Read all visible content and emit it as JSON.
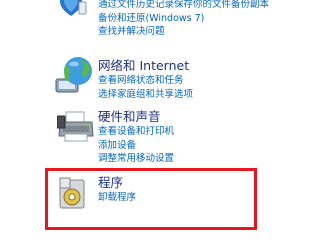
{
  "system": {
    "links": [
      "通过文件历史记录保存你的文件备份副本",
      "备份和还原(Windows 7)",
      "查找并解决问题"
    ]
  },
  "network": {
    "title": "网络和 Internet",
    "links": [
      "查看网络状态和任务",
      "选择家庭组和共享选项"
    ]
  },
  "hardware": {
    "title": "硬件和声音",
    "links": [
      "查看设备和打印机",
      "添加设备",
      "调整常用移动设置"
    ]
  },
  "programs": {
    "title": "程序",
    "links": [
      "卸载程序"
    ]
  },
  "highlight_color": "#e8161d"
}
